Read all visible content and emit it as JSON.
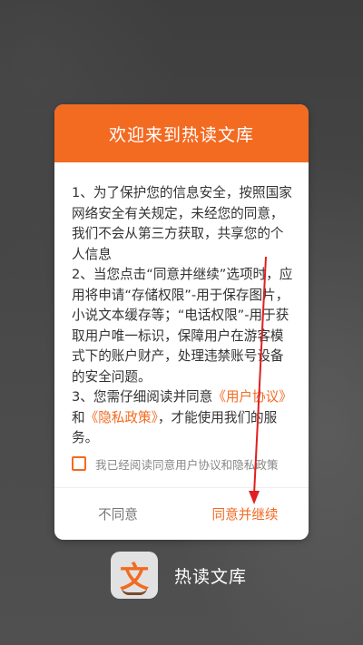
{
  "dialog": {
    "title": "欢迎来到热读文库",
    "para1": "1、为了保护您的信息安全，按照国家网络安全有关规定，未经您的同意，我们不会从第三方获取，共享您的个人信息",
    "para2": "2、当您点击“同意并继续”选项时，应用将申请“存储权限”-用于保存图片，小说文本缓存等；“电话权限”-用于获取用户唯一标识，保障用户在游客模式下的账户财产，处理违禁账号设备的安全问题。",
    "para3_before": "3、您需仔细阅读并同意",
    "user_agreement_link": "《用户协议》",
    "para3_and": "和",
    "privacy_policy_link": "《隐私政策》",
    "para3_after": "，才能使用我们的服务。",
    "agree_checkbox_label": "我已经阅读同意用户协议和隐私政策",
    "disagree_label": "不同意",
    "agree_label": "同意并继续"
  },
  "brand": {
    "logo_glyph": "文",
    "name": "热读文库"
  },
  "colors": {
    "accent": "#f36a21",
    "annotation_arrow": "#e02020"
  }
}
